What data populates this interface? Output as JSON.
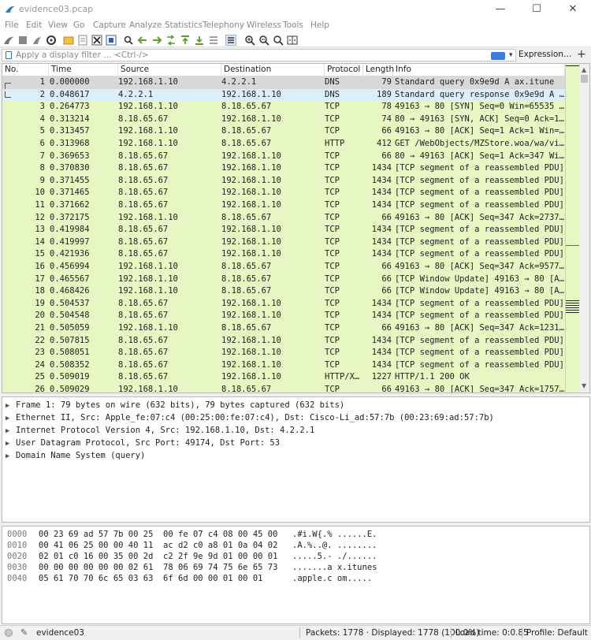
{
  "window": {
    "title": "evidence03.pcap",
    "minimize": "—",
    "maximize": "☐",
    "close": "✕"
  },
  "menu": [
    "File",
    "Edit",
    "View",
    "Go",
    "Capture",
    "Analyze",
    "Statistics",
    "Telephony",
    "Wireless",
    "Tools",
    "Help"
  ],
  "toolbar_icons": [
    "shark-fin-start-icon",
    "stop-icon",
    "restart-icon",
    "options-gear-icon",
    "open-folder-icon",
    "save-icon",
    "close-file-icon",
    "reload-icon",
    "find-icon",
    "back-arrow-icon",
    "forward-arrow-icon",
    "goto-packet-icon",
    "first-packet-icon",
    "last-packet-icon",
    "autoscroll-icon",
    "colorize-icon",
    "zoom-in-icon",
    "zoom-out-icon",
    "zoom-normal-icon",
    "resize-columns-icon"
  ],
  "filter": {
    "placeholder": "Apply a display filter … <Ctrl-/>",
    "expression_label": "Expression…",
    "plus_label": "+",
    "dropdown": "▾"
  },
  "packet_list": {
    "columns": [
      "No.",
      "Time",
      "Source",
      "Destination",
      "Protocol",
      "Length",
      "Info"
    ],
    "rows": [
      {
        "no": "1",
        "time": "0.000000",
        "src": "192.168.1.10",
        "dst": "4.2.2.1",
        "proto": "DNS",
        "len": "79",
        "info": "Standard query 0x9e9d A ax.itune",
        "kind": "dns-sel"
      },
      {
        "no": "2",
        "time": "0.048617",
        "src": "4.2.2.1",
        "dst": "192.168.1.10",
        "proto": "DNS",
        "len": "189",
        "info": "Standard query response 0x9e9d A …",
        "kind": "dns"
      },
      {
        "no": "3",
        "time": "0.264773",
        "src": "192.168.1.10",
        "dst": "8.18.65.67",
        "proto": "TCP",
        "len": "78",
        "info": "49163 → 80 [SYN] Seq=0 Win=65535 …",
        "kind": "tcp"
      },
      {
        "no": "4",
        "time": "0.313214",
        "src": "8.18.65.67",
        "dst": "192.168.1.10",
        "proto": "TCP",
        "len": "74",
        "info": "80 → 49163 [SYN, ACK] Seq=0 Ack=1…",
        "kind": "tcp"
      },
      {
        "no": "5",
        "time": "0.313457",
        "src": "192.168.1.10",
        "dst": "8.18.65.67",
        "proto": "TCP",
        "len": "66",
        "info": "49163 → 80 [ACK] Seq=1 Ack=1 Win=…",
        "kind": "tcp"
      },
      {
        "no": "6",
        "time": "0.313968",
        "src": "192.168.1.10",
        "dst": "8.18.65.67",
        "proto": "HTTP",
        "len": "412",
        "info": "GET /WebObjects/MZStore.woa/wa/vi…",
        "kind": "tcp"
      },
      {
        "no": "7",
        "time": "0.369653",
        "src": "8.18.65.67",
        "dst": "192.168.1.10",
        "proto": "TCP",
        "len": "66",
        "info": "80 → 49163 [ACK] Seq=1 Ack=347 Wi…",
        "kind": "tcp"
      },
      {
        "no": "8",
        "time": "0.370830",
        "src": "8.18.65.67",
        "dst": "192.168.1.10",
        "proto": "TCP",
        "len": "1434",
        "info": "[TCP segment of a reassembled PDU]",
        "kind": "tcp"
      },
      {
        "no": "9",
        "time": "0.371455",
        "src": "8.18.65.67",
        "dst": "192.168.1.10",
        "proto": "TCP",
        "len": "1434",
        "info": "[TCP segment of a reassembled PDU]",
        "kind": "tcp"
      },
      {
        "no": "10",
        "time": "0.371465",
        "src": "8.18.65.67",
        "dst": "192.168.1.10",
        "proto": "TCP",
        "len": "1434",
        "info": "[TCP segment of a reassembled PDU]",
        "kind": "tcp"
      },
      {
        "no": "11",
        "time": "0.371662",
        "src": "8.18.65.67",
        "dst": "192.168.1.10",
        "proto": "TCP",
        "len": "1434",
        "info": "[TCP segment of a reassembled PDU]",
        "kind": "tcp"
      },
      {
        "no": "12",
        "time": "0.372175",
        "src": "192.168.1.10",
        "dst": "8.18.65.67",
        "proto": "TCP",
        "len": "66",
        "info": "49163 → 80 [ACK] Seq=347 Ack=2737…",
        "kind": "tcp"
      },
      {
        "no": "13",
        "time": "0.419984",
        "src": "8.18.65.67",
        "dst": "192.168.1.10",
        "proto": "TCP",
        "len": "1434",
        "info": "[TCP segment of a reassembled PDU]",
        "kind": "tcp"
      },
      {
        "no": "14",
        "time": "0.419997",
        "src": "8.18.65.67",
        "dst": "192.168.1.10",
        "proto": "TCP",
        "len": "1434",
        "info": "[TCP segment of a reassembled PDU]",
        "kind": "tcp"
      },
      {
        "no": "15",
        "time": "0.421936",
        "src": "8.18.65.67",
        "dst": "192.168.1.10",
        "proto": "TCP",
        "len": "1434",
        "info": "[TCP segment of a reassembled PDU]",
        "kind": "tcp"
      },
      {
        "no": "16",
        "time": "0.456994",
        "src": "192.168.1.10",
        "dst": "8.18.65.67",
        "proto": "TCP",
        "len": "66",
        "info": "49163 → 80 [ACK] Seq=347 Ack=9577…",
        "kind": "tcp"
      },
      {
        "no": "17",
        "time": "0.465567",
        "src": "192.168.1.10",
        "dst": "8.18.65.67",
        "proto": "TCP",
        "len": "66",
        "info": "[TCP Window Update] 49163 → 80 [A…",
        "kind": "tcp"
      },
      {
        "no": "18",
        "time": "0.468426",
        "src": "192.168.1.10",
        "dst": "8.18.65.67",
        "proto": "TCP",
        "len": "66",
        "info": "[TCP Window Update] 49163 → 80 [A…",
        "kind": "tcp"
      },
      {
        "no": "19",
        "time": "0.504537",
        "src": "8.18.65.67",
        "dst": "192.168.1.10",
        "proto": "TCP",
        "len": "1434",
        "info": "[TCP segment of a reassembled PDU]",
        "kind": "tcp"
      },
      {
        "no": "20",
        "time": "0.504548",
        "src": "8.18.65.67",
        "dst": "192.168.1.10",
        "proto": "TCP",
        "len": "1434",
        "info": "[TCP segment of a reassembled PDU]",
        "kind": "tcp"
      },
      {
        "no": "21",
        "time": "0.505059",
        "src": "192.168.1.10",
        "dst": "8.18.65.67",
        "proto": "TCP",
        "len": "66",
        "info": "49163 → 80 [ACK] Seq=347 Ack=1231…",
        "kind": "tcp"
      },
      {
        "no": "22",
        "time": "0.507815",
        "src": "8.18.65.67",
        "dst": "192.168.1.10",
        "proto": "TCP",
        "len": "1434",
        "info": "[TCP segment of a reassembled PDU]",
        "kind": "tcp"
      },
      {
        "no": "23",
        "time": "0.508051",
        "src": "8.18.65.67",
        "dst": "192.168.1.10",
        "proto": "TCP",
        "len": "1434",
        "info": "[TCP segment of a reassembled PDU]",
        "kind": "tcp"
      },
      {
        "no": "24",
        "time": "0.508352",
        "src": "8.18.65.67",
        "dst": "192.168.1.10",
        "proto": "TCP",
        "len": "1434",
        "info": "[TCP segment of a reassembled PDU]",
        "kind": "tcp"
      },
      {
        "no": "25",
        "time": "0.509019",
        "src": "8.18.65.67",
        "dst": "192.168.1.10",
        "proto": "HTTP/X…",
        "len": "1227",
        "info": "HTTP/1.1 200 OK",
        "kind": "tcp"
      },
      {
        "no": "26",
        "time": "0.509029",
        "src": "192.168.1.10",
        "dst": "8.18.65.67",
        "proto": "TCP",
        "len": "66",
        "info": "49163 → 80 [ACK] Seq=347 Ack=1757…",
        "kind": "tcp"
      }
    ]
  },
  "details": [
    "Frame 1: 79 bytes on wire (632 bits), 79 bytes captured (632 bits)",
    "Ethernet II, Src: Apple_fe:07:c4 (00:25:00:fe:07:c4), Dst: Cisco-Li_ad:57:7b (00:23:69:ad:57:7b)",
    "Internet Protocol Version 4, Src: 192.168.1.10, Dst: 4.2.2.1",
    "User Datagram Protocol, Src Port: 49174, Dst Port: 53",
    "Domain Name System (query)"
  ],
  "detail_arrow": "▶",
  "hex": [
    {
      "off": "0000",
      "bytes": "00 23 69 ad 57 7b 00 25  00 fe 07 c4 08 00 45 00",
      "ascii": ".#i.W{.% ......E."
    },
    {
      "off": "0010",
      "bytes": "00 41 06 25 00 00 40 11  ac d2 c0 a8 01 0a 04 02",
      "ascii": ".A.%..@. ........"
    },
    {
      "off": "0020",
      "bytes": "02 01 c0 16 00 35 00 2d  c2 2f 9e 9d 01 00 00 01",
      "ascii": ".....5.- ./......"
    },
    {
      "off": "0030",
      "bytes": "00 00 00 00 00 00 02 61  78 06 69 74 75 6e 65 73",
      "ascii": ".......a x.itunes"
    },
    {
      "off": "0040",
      "bytes": "05 61 70 70 6c 65 03 63  6f 6d 00 00 01 00 01",
      "ascii": ".apple.c om....."
    }
  ],
  "status": {
    "file": "evidence03",
    "packets": "Packets: 1778 · Displayed: 1778 (100.0%)",
    "load_time": "Load time: 0:0.85",
    "profile": "Profile: Default",
    "edit_glyph": "✎"
  },
  "colors": {
    "tcp_row": "#e7f7c3",
    "dns_row": "#daeefc",
    "selected_row": "#d8d8d8",
    "accent": "#3b7ddd"
  }
}
